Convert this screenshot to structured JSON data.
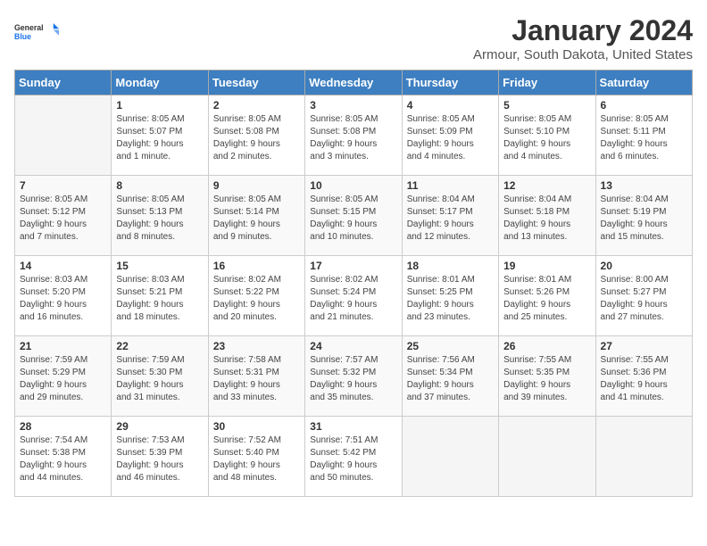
{
  "logo": {
    "line1": "General",
    "line2": "Blue"
  },
  "title": "January 2024",
  "subtitle": "Armour, South Dakota, United States",
  "days_of_week": [
    "Sunday",
    "Monday",
    "Tuesday",
    "Wednesday",
    "Thursday",
    "Friday",
    "Saturday"
  ],
  "weeks": [
    [
      {
        "num": "",
        "info": ""
      },
      {
        "num": "1",
        "info": "Sunrise: 8:05 AM\nSunset: 5:07 PM\nDaylight: 9 hours\nand 1 minute."
      },
      {
        "num": "2",
        "info": "Sunrise: 8:05 AM\nSunset: 5:08 PM\nDaylight: 9 hours\nand 2 minutes."
      },
      {
        "num": "3",
        "info": "Sunrise: 8:05 AM\nSunset: 5:08 PM\nDaylight: 9 hours\nand 3 minutes."
      },
      {
        "num": "4",
        "info": "Sunrise: 8:05 AM\nSunset: 5:09 PM\nDaylight: 9 hours\nand 4 minutes."
      },
      {
        "num": "5",
        "info": "Sunrise: 8:05 AM\nSunset: 5:10 PM\nDaylight: 9 hours\nand 4 minutes."
      },
      {
        "num": "6",
        "info": "Sunrise: 8:05 AM\nSunset: 5:11 PM\nDaylight: 9 hours\nand 6 minutes."
      }
    ],
    [
      {
        "num": "7",
        "info": "Sunrise: 8:05 AM\nSunset: 5:12 PM\nDaylight: 9 hours\nand 7 minutes."
      },
      {
        "num": "8",
        "info": "Sunrise: 8:05 AM\nSunset: 5:13 PM\nDaylight: 9 hours\nand 8 minutes."
      },
      {
        "num": "9",
        "info": "Sunrise: 8:05 AM\nSunset: 5:14 PM\nDaylight: 9 hours\nand 9 minutes."
      },
      {
        "num": "10",
        "info": "Sunrise: 8:05 AM\nSunset: 5:15 PM\nDaylight: 9 hours\nand 10 minutes."
      },
      {
        "num": "11",
        "info": "Sunrise: 8:04 AM\nSunset: 5:17 PM\nDaylight: 9 hours\nand 12 minutes."
      },
      {
        "num": "12",
        "info": "Sunrise: 8:04 AM\nSunset: 5:18 PM\nDaylight: 9 hours\nand 13 minutes."
      },
      {
        "num": "13",
        "info": "Sunrise: 8:04 AM\nSunset: 5:19 PM\nDaylight: 9 hours\nand 15 minutes."
      }
    ],
    [
      {
        "num": "14",
        "info": "Sunrise: 8:03 AM\nSunset: 5:20 PM\nDaylight: 9 hours\nand 16 minutes."
      },
      {
        "num": "15",
        "info": "Sunrise: 8:03 AM\nSunset: 5:21 PM\nDaylight: 9 hours\nand 18 minutes."
      },
      {
        "num": "16",
        "info": "Sunrise: 8:02 AM\nSunset: 5:22 PM\nDaylight: 9 hours\nand 20 minutes."
      },
      {
        "num": "17",
        "info": "Sunrise: 8:02 AM\nSunset: 5:24 PM\nDaylight: 9 hours\nand 21 minutes."
      },
      {
        "num": "18",
        "info": "Sunrise: 8:01 AM\nSunset: 5:25 PM\nDaylight: 9 hours\nand 23 minutes."
      },
      {
        "num": "19",
        "info": "Sunrise: 8:01 AM\nSunset: 5:26 PM\nDaylight: 9 hours\nand 25 minutes."
      },
      {
        "num": "20",
        "info": "Sunrise: 8:00 AM\nSunset: 5:27 PM\nDaylight: 9 hours\nand 27 minutes."
      }
    ],
    [
      {
        "num": "21",
        "info": "Sunrise: 7:59 AM\nSunset: 5:29 PM\nDaylight: 9 hours\nand 29 minutes."
      },
      {
        "num": "22",
        "info": "Sunrise: 7:59 AM\nSunset: 5:30 PM\nDaylight: 9 hours\nand 31 minutes."
      },
      {
        "num": "23",
        "info": "Sunrise: 7:58 AM\nSunset: 5:31 PM\nDaylight: 9 hours\nand 33 minutes."
      },
      {
        "num": "24",
        "info": "Sunrise: 7:57 AM\nSunset: 5:32 PM\nDaylight: 9 hours\nand 35 minutes."
      },
      {
        "num": "25",
        "info": "Sunrise: 7:56 AM\nSunset: 5:34 PM\nDaylight: 9 hours\nand 37 minutes."
      },
      {
        "num": "26",
        "info": "Sunrise: 7:55 AM\nSunset: 5:35 PM\nDaylight: 9 hours\nand 39 minutes."
      },
      {
        "num": "27",
        "info": "Sunrise: 7:55 AM\nSunset: 5:36 PM\nDaylight: 9 hours\nand 41 minutes."
      }
    ],
    [
      {
        "num": "28",
        "info": "Sunrise: 7:54 AM\nSunset: 5:38 PM\nDaylight: 9 hours\nand 44 minutes."
      },
      {
        "num": "29",
        "info": "Sunrise: 7:53 AM\nSunset: 5:39 PM\nDaylight: 9 hours\nand 46 minutes."
      },
      {
        "num": "30",
        "info": "Sunrise: 7:52 AM\nSunset: 5:40 PM\nDaylight: 9 hours\nand 48 minutes."
      },
      {
        "num": "31",
        "info": "Sunrise: 7:51 AM\nSunset: 5:42 PM\nDaylight: 9 hours\nand 50 minutes."
      },
      {
        "num": "",
        "info": ""
      },
      {
        "num": "",
        "info": ""
      },
      {
        "num": "",
        "info": ""
      }
    ]
  ]
}
